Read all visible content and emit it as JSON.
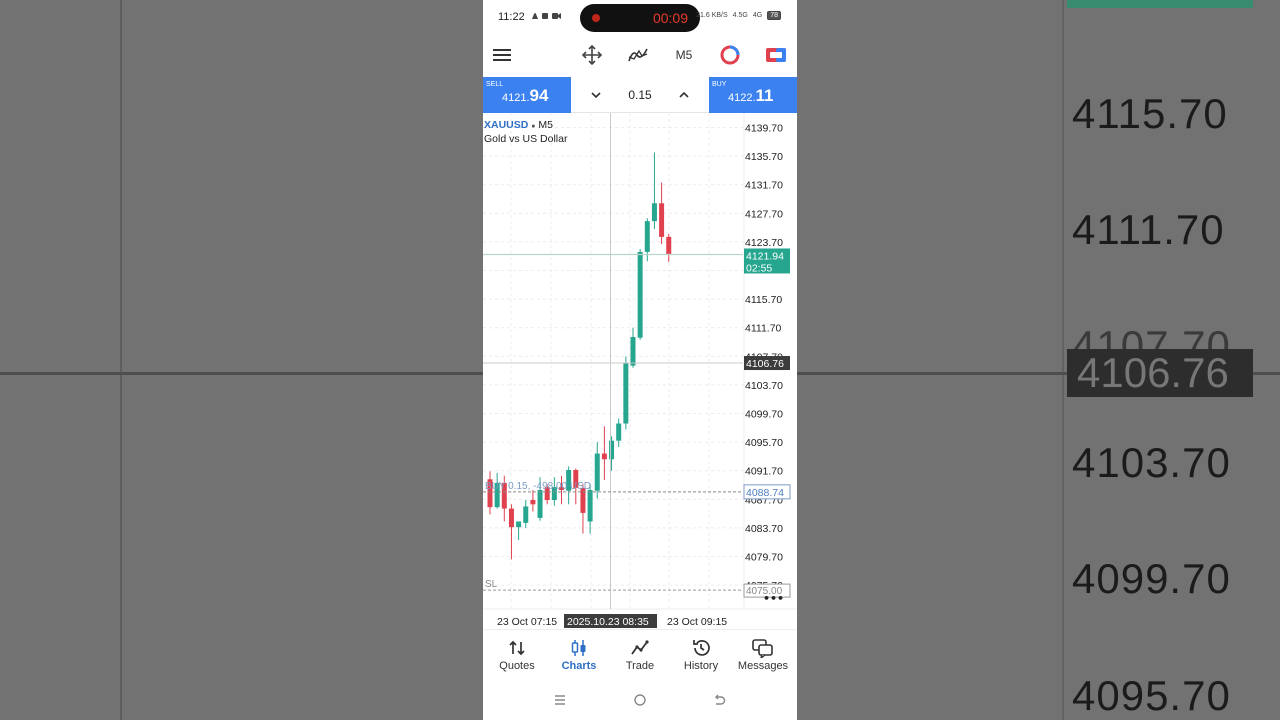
{
  "status": {
    "time": "11:22",
    "recording_time": "00:09",
    "battery": "78",
    "network_labels": [
      "21.6 KB/S",
      "4.5G",
      "4G"
    ]
  },
  "toolbar": {
    "timeframe": "M5"
  },
  "trade": {
    "sell_label": "SELL",
    "sell_price_prefix": "4121.",
    "sell_price_big": "94",
    "buy_label": "BUY",
    "buy_price_prefix": "4122.",
    "buy_price_big": "11",
    "lot": "0.15"
  },
  "chart": {
    "symbol": "XAUUSD",
    "timeframe": "M5",
    "description": "Gold vs US Dollar",
    "price_ticks": [
      "4139.70",
      "4135.70",
      "4131.70",
      "4127.70",
      "4123.70",
      "4115.70",
      "4111.70",
      "4103.70",
      "4099.70",
      "4095.70",
      "4091.70",
      "4083.70",
      "4079.70"
    ],
    "current_price": "4121.94",
    "countdown": "02:55",
    "crosshair_price": "4106.76",
    "partial_tick_1": "4107.70",
    "partial_tick_2": "4087.70",
    "partial_tick_3": "4075.70",
    "order_label": "BUY 0.15, -498.00 USD",
    "order_price": "4088.74",
    "sl_label": "SL",
    "sl_price": "4075.00",
    "time_left": "23 Oct 07:15",
    "time_cross": "2025.10.23 08:35",
    "time_right": "23 Oct 09:15",
    "more": "•••"
  },
  "chart_data": {
    "type": "candlestick",
    "symbol": "XAUUSD",
    "timeframe": "M5",
    "yticks": [
      4139.7,
      4135.7,
      4131.7,
      4127.7,
      4123.7,
      4119.7,
      4115.7,
      4111.7,
      4107.7,
      4103.7,
      4099.7,
      4095.7,
      4091.7,
      4087.7,
      4083.7,
      4079.7,
      4075.7
    ],
    "candles": [
      {
        "o": 4090.5,
        "h": 4091.6,
        "l": 4085.6,
        "c": 4086.6
      },
      {
        "o": 4086.6,
        "h": 4091.4,
        "l": 4086.4,
        "c": 4090.0
      },
      {
        "o": 4090.0,
        "h": 4091.0,
        "l": 4084.6,
        "c": 4086.4
      },
      {
        "o": 4086.4,
        "h": 4087.0,
        "l": 4079.3,
        "c": 4083.8
      },
      {
        "o": 4083.8,
        "h": 4084.6,
        "l": 4082.0,
        "c": 4084.6
      },
      {
        "o": 4084.4,
        "h": 4087.6,
        "l": 4083.7,
        "c": 4086.7
      },
      {
        "o": 4087.6,
        "h": 4089.0,
        "l": 4086.0,
        "c": 4087.0
      },
      {
        "o": 4085.1,
        "h": 4090.8,
        "l": 4084.7,
        "c": 4089.0
      },
      {
        "o": 4089.4,
        "h": 4089.8,
        "l": 4087.0,
        "c": 4087.6
      },
      {
        "o": 4087.6,
        "h": 4090.8,
        "l": 4086.8,
        "c": 4089.4
      },
      {
        "o": 4089.4,
        "h": 4091.0,
        "l": 4087.0,
        "c": 4089.0
      },
      {
        "o": 4088.9,
        "h": 4092.3,
        "l": 4087.0,
        "c": 4091.8
      },
      {
        "o": 4091.8,
        "h": 4092.0,
        "l": 4087.0,
        "c": 4089.3
      },
      {
        "o": 4089.3,
        "h": 4089.8,
        "l": 4082.9,
        "c": 4085.8
      },
      {
        "o": 4084.6,
        "h": 4089.9,
        "l": 4082.9,
        "c": 4089.0
      },
      {
        "o": 4088.9,
        "h": 4095.7,
        "l": 4087.8,
        "c": 4094.1
      },
      {
        "o": 4094.1,
        "h": 4097.9,
        "l": 4090.4,
        "c": 4093.3
      },
      {
        "o": 4093.3,
        "h": 4096.5,
        "l": 4091.7,
        "c": 4095.9
      },
      {
        "o": 4095.9,
        "h": 4099.0,
        "l": 4095.0,
        "c": 4098.3
      },
      {
        "o": 4098.3,
        "h": 4107.7,
        "l": 4097.5,
        "c": 4106.7
      },
      {
        "o": 4106.4,
        "h": 4111.7,
        "l": 4106.1,
        "c": 4110.4
      },
      {
        "o": 4110.3,
        "h": 4122.7,
        "l": 4110.0,
        "c": 4122.3
      },
      {
        "o": 4122.3,
        "h": 4127.0,
        "l": 4121.0,
        "c": 4126.6
      },
      {
        "o": 4126.6,
        "h": 4136.2,
        "l": 4125.5,
        "c": 4129.1
      },
      {
        "o": 4129.1,
        "h": 4132.0,
        "l": 4123.4,
        "c": 4124.4
      },
      {
        "o": 4124.4,
        "h": 4124.8,
        "l": 4120.9,
        "c": 4121.9
      }
    ],
    "bid": 4121.94,
    "crosshair": 4106.76,
    "position": {
      "side": "BUY",
      "volume": 0.15,
      "price": 4088.74,
      "profit": -498.0,
      "currency": "USD"
    },
    "stop_loss": 4075.0,
    "time_axis": [
      "23 Oct 07:15",
      "2025.10.23 08:35",
      "23 Oct 09:15"
    ],
    "grid": true,
    "colors": {
      "up": "#26a68f",
      "down": "#e0414f",
      "crosshair": "#c9c9c9",
      "order": "#7c9bc5"
    }
  },
  "nav": {
    "items": [
      {
        "label": "Quotes",
        "icon": "quotes-icon"
      },
      {
        "label": "Charts",
        "icon": "charts-icon"
      },
      {
        "label": "Trade",
        "icon": "trade-icon"
      },
      {
        "label": "History",
        "icon": "history-icon"
      },
      {
        "label": "Messages",
        "icon": "messages-icon"
      }
    ],
    "active": "Charts"
  },
  "background": {
    "prices": [
      "4115.70",
      "4111.70",
      "4107.70",
      "4103.70",
      "4099.70",
      "4095.70"
    ],
    "highlight": "4106.76"
  },
  "colors": {
    "accent": "#3b82f0",
    "active_nav": "#2f6fc5",
    "price_tag_green": "#26a68f",
    "crosshair_tag": "#3c3c3c"
  }
}
